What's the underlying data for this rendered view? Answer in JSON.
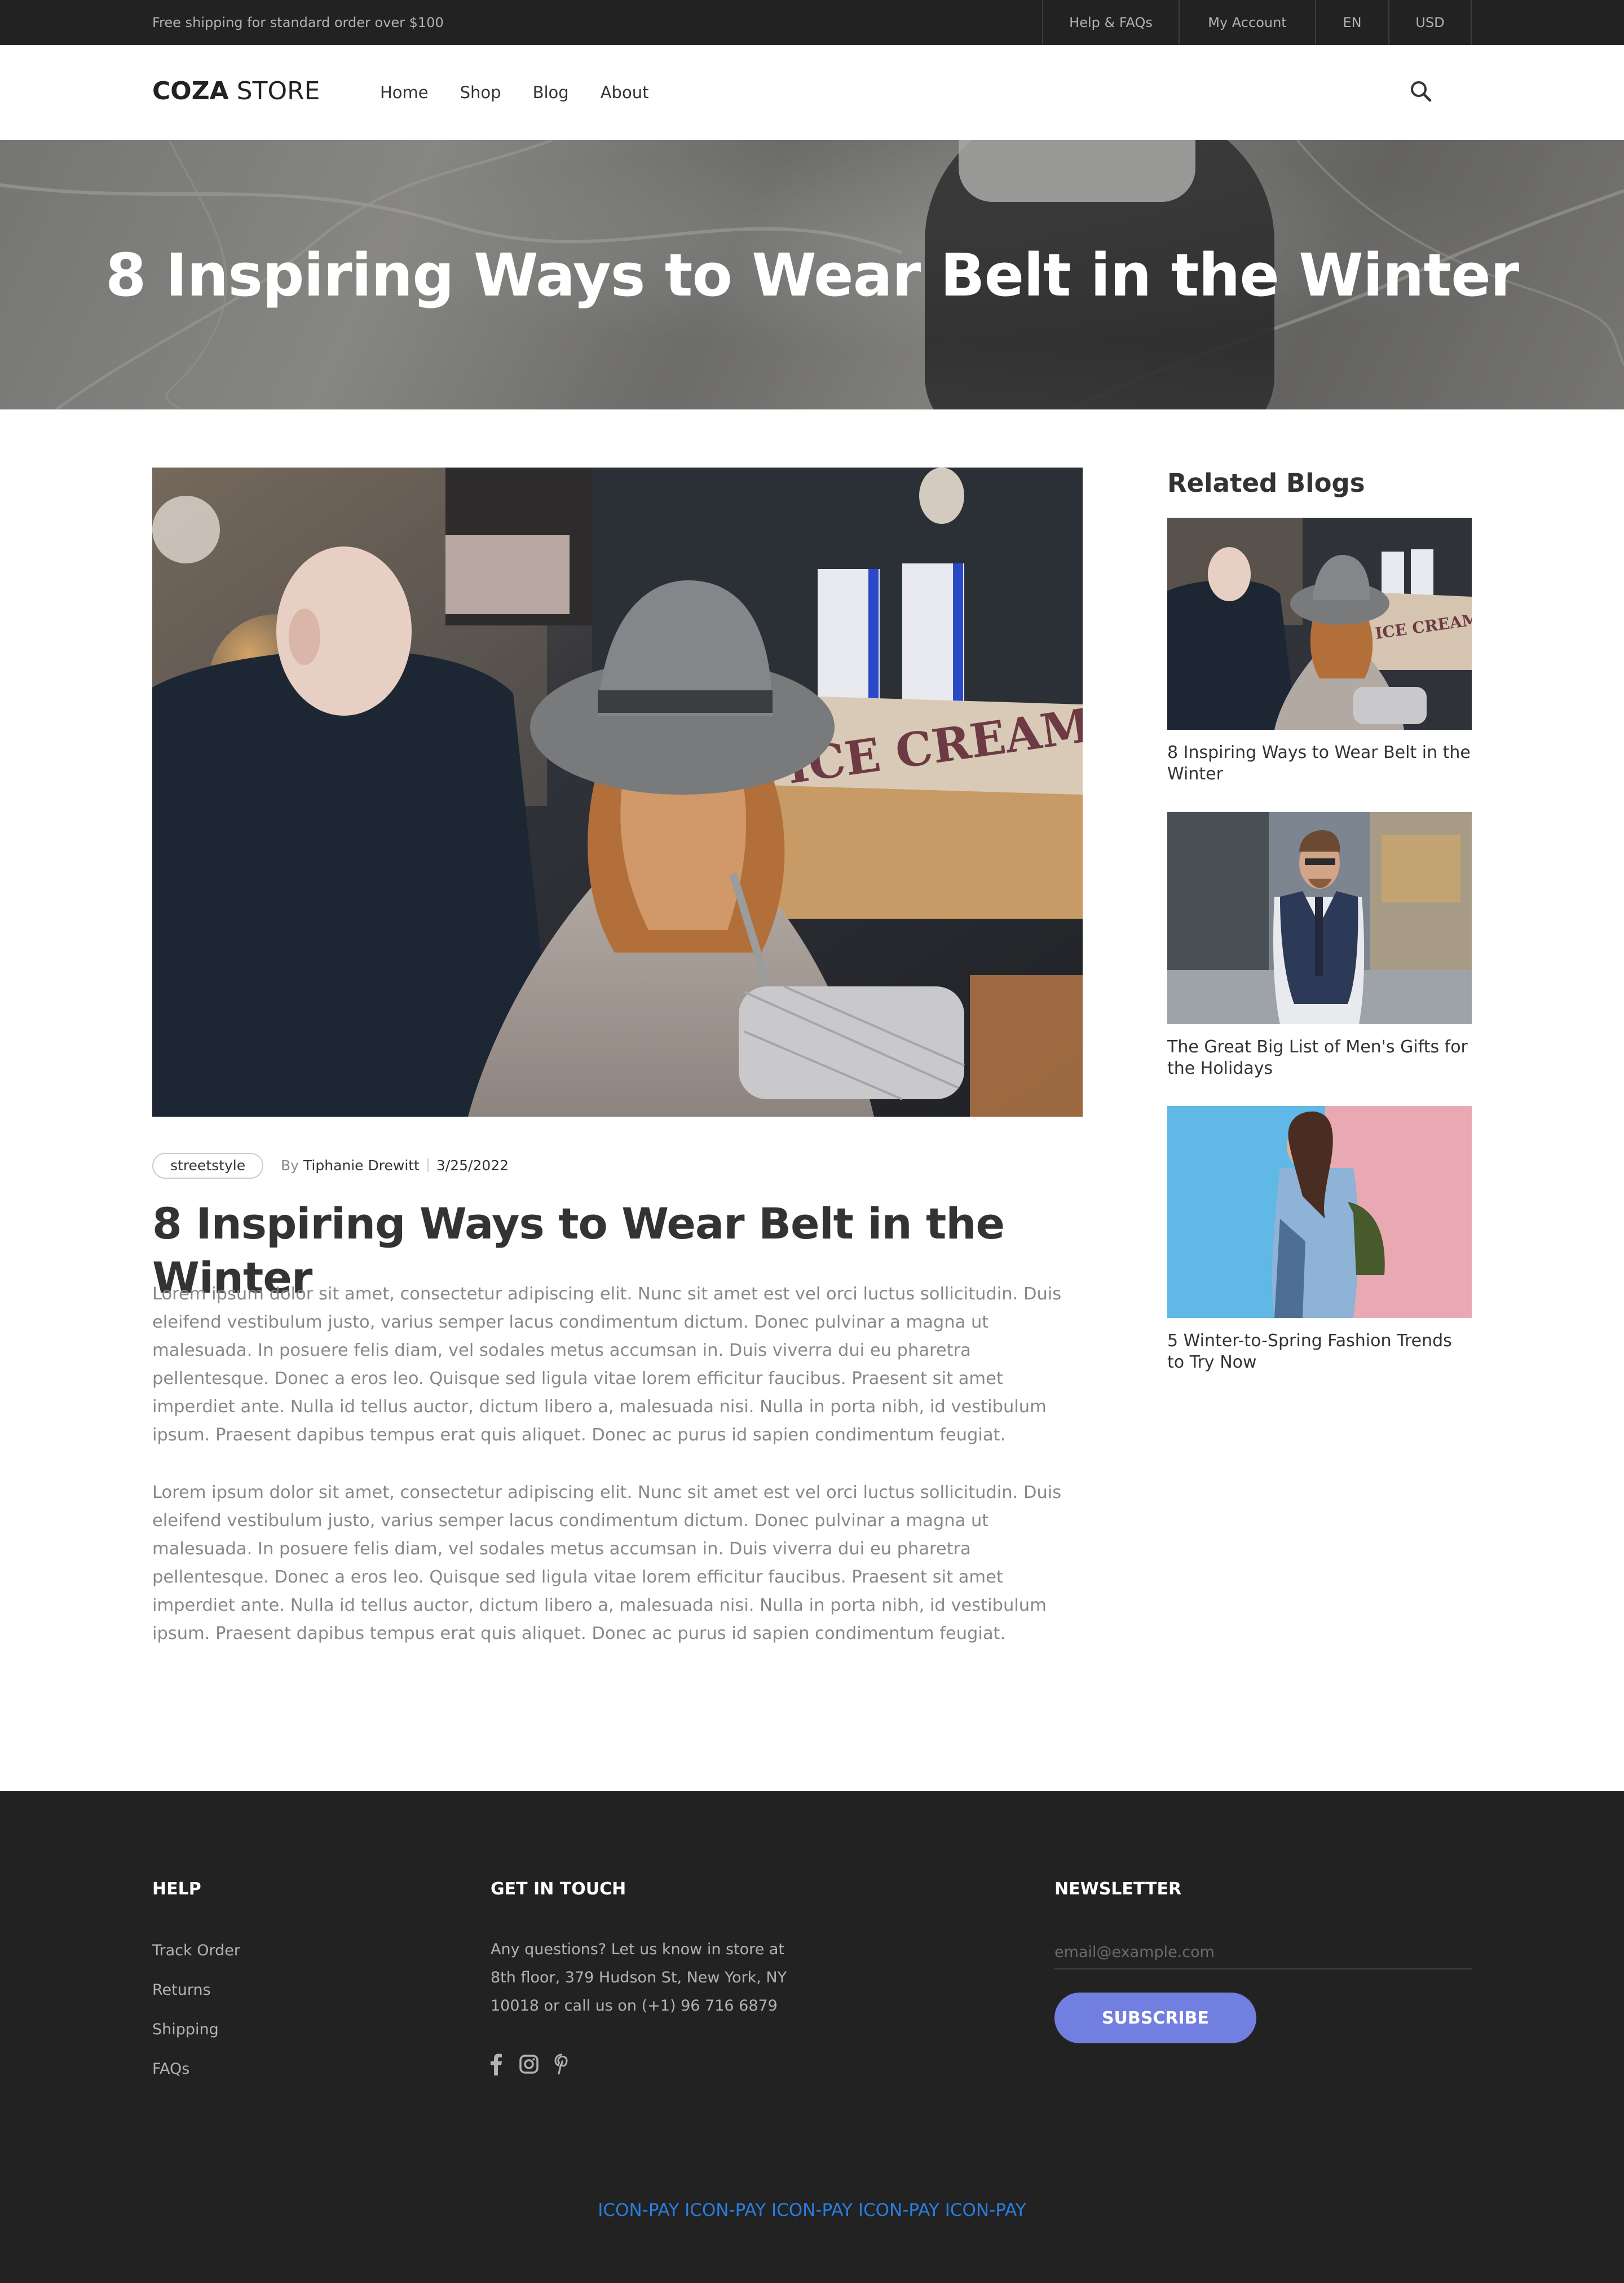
{
  "topbar": {
    "promo": "Free shipping for standard order over $100",
    "links": [
      "Help & FAQs",
      "My Account",
      "EN",
      "USD"
    ]
  },
  "header": {
    "logo_bold": "COZA",
    "logo_light": " STORE",
    "nav": [
      "Home",
      "Shop",
      "Blog",
      "About"
    ]
  },
  "hero": {
    "title": "8 Inspiring Ways to Wear Belt in the Winter"
  },
  "article": {
    "tag": "streetstyle",
    "by": "By ",
    "author": "Tiphanie Drewitt",
    "date": "3/25/2022",
    "title": "8 Inspiring Ways to Wear Belt in the Winter",
    "paragraphs": [
      "Lorem ipsum dolor sit amet, consectetur adipiscing elit. Nunc sit amet est vel orci luctus sollicitudin. Duis eleifend vestibulum justo, varius semper lacus condimentum dictum. Donec pulvinar a magna ut malesuada. In posuere felis diam, vel sodales metus accumsan in. Duis viverra dui eu pharetra pellentesque. Donec a eros leo. Quisque sed ligula vitae lorem efficitur faucibus. Praesent sit amet imperdiet ante. Nulla id tellus auctor, dictum libero a, malesuada nisi. Nulla in porta nibh, id vestibulum ipsum. Praesent dapibus tempus erat quis aliquet. Donec ac purus id sapien condimentum feugiat.",
      "Lorem ipsum dolor sit amet, consectetur adipiscing elit. Nunc sit amet est vel orci luctus sollicitudin. Duis eleifend vestibulum justo, varius semper lacus condimentum dictum. Donec pulvinar a magna ut malesuada. In posuere felis diam, vel sodales metus accumsan in. Duis viverra dui eu pharetra pellentesque. Donec a eros leo. Quisque sed ligula vitae lorem efficitur faucibus. Praesent sit amet imperdiet ante. Nulla id tellus auctor, dictum libero a, malesuada nisi. Nulla in porta nibh, id vestibulum ipsum. Praesent dapibus tempus erat quis aliquet. Donec ac purus id sapien condimentum feugiat."
    ]
  },
  "sidebar": {
    "title": "Related Blogs",
    "items": [
      {
        "caption": "8 Inspiring Ways to Wear Belt in the Winter"
      },
      {
        "caption": "The Great Big List of Men's Gifts for the Holidays"
      },
      {
        "caption": "5 Winter-to-Spring Fashion Trends to Try Now"
      }
    ]
  },
  "footer": {
    "help": {
      "title": "HELP",
      "links": [
        "Track Order",
        "Returns",
        "Shipping",
        "FAQs"
      ]
    },
    "contact": {
      "title": "GET IN TOUCH",
      "text": "Any questions? Let us know in store at 8th floor, 379 Hudson St, New York, NY 10018 or call us on (+1) 96 716 6879",
      "social_icons": [
        "facebook-icon",
        "instagram-icon",
        "pinterest-icon"
      ]
    },
    "newsletter": {
      "title": "NEWSLETTER",
      "placeholder": "email@example.com",
      "button": "SUBSCRIBE"
    },
    "payment": "ICON-PAY ICON-PAY ICON-PAY ICON-PAY ICON-PAY"
  },
  "colors": {
    "topbar_bg": "#222222",
    "footer_bg": "#222222",
    "accent": "#717fe0",
    "payment_text": "#2a7de1",
    "body_text": "#888888",
    "heading_text": "#333333"
  }
}
